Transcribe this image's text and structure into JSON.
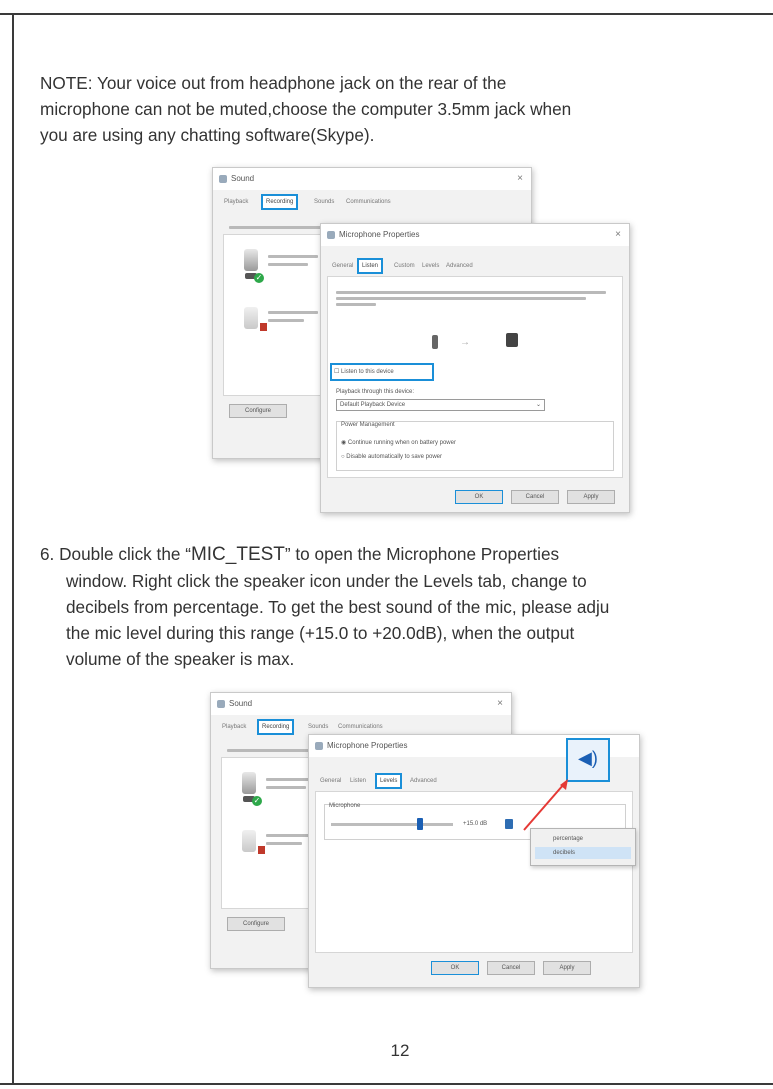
{
  "note": {
    "text": "NOTE: Your voice out from headphone jack on the rear of the\nmicrophone can not be muted,choose the computer 3.5mm jack when\nyou are using any chatting software(Skype)."
  },
  "step6": {
    "num": "6.",
    "pre": " Double click the “",
    "quoted": "MIC_TEST",
    "post": "”  to open the Microphone Properties",
    "line2": "window. Right click the speaker icon under the Levels tab, change to",
    "line3": "decibels from percentage. To get the best sound of the mic, please adju",
    "line4": "the mic level during this range (+15.0 to +20.0dB), when the output",
    "line5": "volume of the speaker is max."
  },
  "page_number": "12",
  "screenshot1": {
    "sound_window": {
      "title": "Sound",
      "close": "×",
      "tabs": [
        "Playback",
        "Recording",
        "Sounds",
        "Communications"
      ],
      "selected_tab": 1,
      "button": "Configure"
    },
    "props_window": {
      "title": "Microphone Properties",
      "close": "×",
      "tabs": [
        "General",
        "Listen",
        "Custom",
        "Levels",
        "Advanced"
      ],
      "selected_tab": 1,
      "listen_checkbox": "Listen to this device",
      "playback_label": "Playback through this device:",
      "playback_value": "Default Playback Device",
      "power_group": "Power Management",
      "radio1": "Continue running when on battery power",
      "radio2": "Disable automatically to save power",
      "ok": "OK",
      "cancel": "Cancel",
      "apply": "Apply"
    }
  },
  "screenshot2": {
    "sound_window": {
      "title": "Sound",
      "close": "×",
      "tabs": [
        "Playback",
        "Recording",
        "Sounds",
        "Communications"
      ],
      "selected_tab": 1,
      "button": "Configure"
    },
    "props_window": {
      "title": "Microphone Properties",
      "tabs": [
        "General",
        "Listen",
        "Levels",
        "Advanced"
      ],
      "selected_tab": 2,
      "group_label": "Microphone",
      "level_value": "+15.0 dB",
      "ok": "OK",
      "cancel": "Cancel",
      "apply": "Apply"
    },
    "context_menu": [
      "percentage",
      "decibels"
    ],
    "context_menu_selected": 1
  },
  "colors": {
    "highlight": "#1a8fd8",
    "arrow": "#e53935",
    "text": "#333333"
  }
}
